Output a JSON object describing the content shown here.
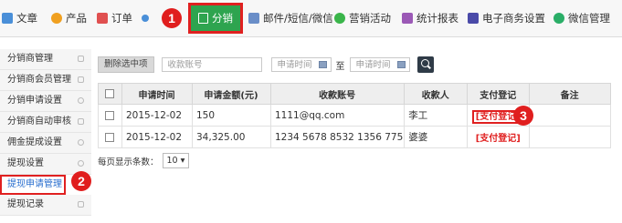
{
  "nav": {
    "items": [
      {
        "label": "文章",
        "icon": "article-icon",
        "color": "#4a8fd8"
      },
      {
        "label": "产品",
        "icon": "lightbulb-icon",
        "color": "#f0a020"
      },
      {
        "label": "订单",
        "icon": "cart-icon",
        "color": "#e05050"
      },
      {
        "label": "分销",
        "icon": "distribution-icon",
        "color": "#2ea44f",
        "active": true
      },
      {
        "label": "邮件/短信/微信",
        "icon": "mail-icon",
        "color": "#6a8ec8"
      },
      {
        "label": "营销活动",
        "icon": "marketing-icon",
        "color": "#3ab54a"
      },
      {
        "label": "统计报表",
        "icon": "chart-icon",
        "color": "#9b59b6"
      },
      {
        "label": "电子商务设置",
        "icon": "ecommerce-settings-icon",
        "color": "#4a4aa8"
      },
      {
        "label": "微信管理",
        "icon": "wechat-icon",
        "color": "#2aae67"
      }
    ],
    "badge1": "1"
  },
  "sidebar": {
    "items": [
      {
        "label": "分销商管理"
      },
      {
        "label": "分销商会员管理"
      },
      {
        "label": "分销申请设置"
      },
      {
        "label": "分销商自动审核"
      },
      {
        "label": "佣金提成设置"
      },
      {
        "label": "提现设置"
      },
      {
        "label": "提现申请管理",
        "selected": true
      },
      {
        "label": "提现记录"
      }
    ],
    "badge2": "2"
  },
  "toolbar": {
    "delete_label": "删除选中项",
    "account_placeholder": "收款账号",
    "date_from_placeholder": "申请时间",
    "to_label": "至",
    "date_to_placeholder": "申请时间"
  },
  "table": {
    "headers": [
      "申请时间",
      "申请金额(元)",
      "收款账号",
      "收款人",
      "支付登记",
      "备注"
    ],
    "rows": [
      {
        "time": "2015-12-02",
        "amount": "150",
        "account": "1111@qq.com",
        "payee": "李工",
        "pay": "[支付登记]",
        "note": ""
      },
      {
        "time": "2015-12-02",
        "amount": "34,325.00",
        "account": "1234 5678 8532 1356 775",
        "payee": "婆婆",
        "pay": "[支付登记]",
        "note": ""
      }
    ],
    "badge3": "3"
  },
  "pagination": {
    "per_page_label": "每页显示条数：",
    "per_page_value": "10"
  }
}
